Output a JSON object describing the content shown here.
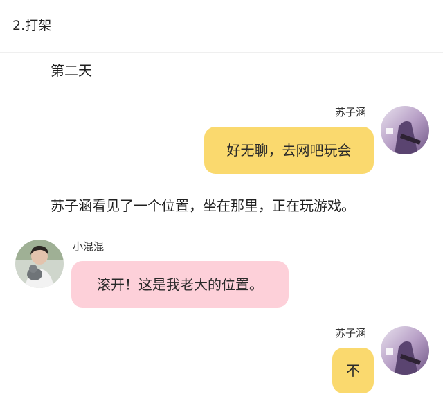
{
  "header": {
    "chapter_title": "2.打架"
  },
  "narration": {
    "day": "第二天",
    "scene": "苏子涵看见了一个位置，坐在那里，正在玩游戏。"
  },
  "messages": [
    {
      "speaker": "苏子涵",
      "text": "好无聊，去网吧玩会",
      "side": "right",
      "bubble_color": "#fad96e",
      "avatar": "purple-character-avatar"
    },
    {
      "speaker": "小混混",
      "text": "滚开！这是我老大的位置。",
      "side": "left",
      "bubble_color": "#fdd0d9",
      "avatar": "boy-with-cat-avatar"
    },
    {
      "speaker": "苏子涵",
      "text": "不",
      "side": "right",
      "bubble_color": "#fad96e",
      "avatar": "purple-character-avatar"
    }
  ]
}
